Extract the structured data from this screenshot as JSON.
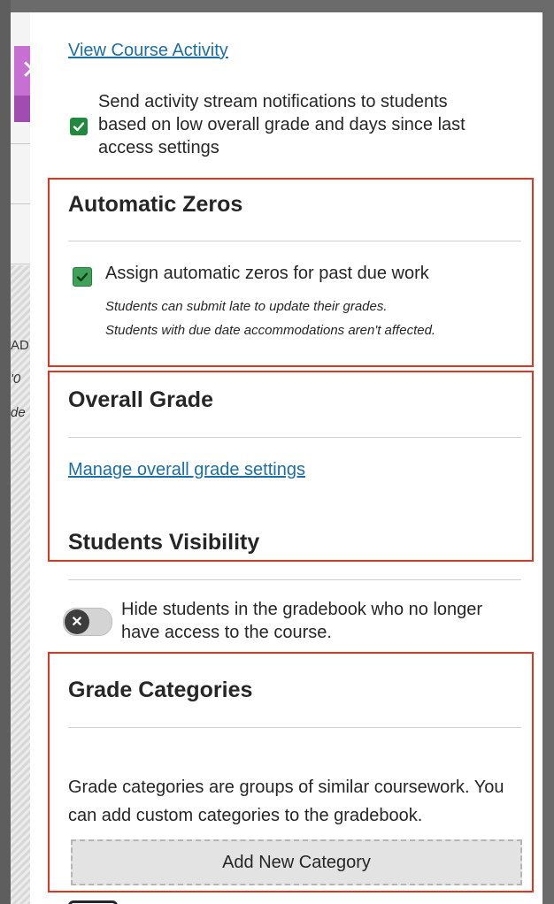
{
  "background": {
    "cropped_texts": [
      "AD",
      "'0",
      "de"
    ]
  },
  "panel": {
    "view_activity_link": "View Course Activity",
    "notify_text": "Send activity stream notifications to students based on low overall grade and days since last access settings",
    "automatic_zeros": {
      "title": "Automatic Zeros",
      "checkbox_label": "Assign automatic zeros for past due work",
      "note_line1": "Students can submit late to update their grades.",
      "note_line2": "Students with due date accommodations aren't affected."
    },
    "overall_grade": {
      "title": "Overall Grade",
      "manage_link": "Manage overall grade settings"
    },
    "students_visibility": {
      "title": "Students Visibility",
      "toggle_text": "Hide students in the gradebook who no longer have access to the course."
    },
    "grade_categories": {
      "title": "Grade Categories",
      "description": "Grade categories are groups of similar coursework. You can add custom categories to the gradebook.",
      "add_button": "Add New Category"
    }
  },
  "colors": {
    "accent_link": "#1b6fa8",
    "checkbox_green": "#1f8a3e",
    "highlight_red": "#e2351f",
    "close_tab_purple": "#c86fd4"
  }
}
